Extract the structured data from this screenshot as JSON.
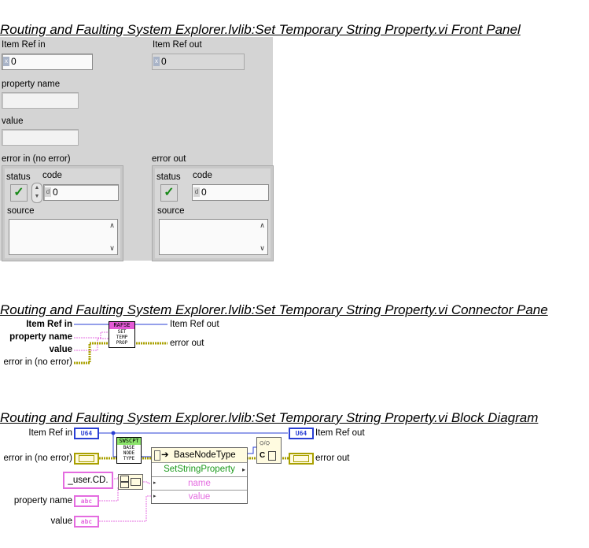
{
  "front_panel": {
    "title": "Routing and Faulting System Explorer.lvlib:Set Temporary String Property.vi Front Panel",
    "item_ref_in": {
      "label": "Item Ref in",
      "radix": "x",
      "value": "0"
    },
    "item_ref_out": {
      "label": "Item Ref out",
      "radix": "x",
      "value": "0"
    },
    "property_name": {
      "label": "property name",
      "value": ""
    },
    "value": {
      "label": "value",
      "value": ""
    },
    "error_in": {
      "label": "error in (no error)",
      "status_label": "status",
      "code_label": "code",
      "code_radix": "d",
      "code_value": "0",
      "source_label": "source",
      "status_glyph": "✓"
    },
    "error_out": {
      "label": "error out",
      "status_label": "status",
      "code_label": "code",
      "code_radix": "d",
      "code_value": "0",
      "source_label": "source",
      "status_glyph": "✓"
    }
  },
  "connector_pane": {
    "title": "Routing and Faulting System Explorer.lvlib:Set Temporary String Property.vi Connector Pane",
    "inputs": [
      "Item Ref in",
      "property name",
      "value",
      "error in (no error)"
    ],
    "outputs": [
      "Item Ref out",
      "error out"
    ],
    "icon_top": "RAFSE",
    "icon_lines": [
      "SET",
      "TEMP",
      "PROP"
    ]
  },
  "block_diagram": {
    "title": "Routing and Faulting System Explorer.lvlib:Set Temporary String Property.vi Block Diagram",
    "item_ref_in": "Item Ref in",
    "item_ref_out": "Item Ref out",
    "error_in": "error in (no error)",
    "error_out": "error out",
    "property_name": "property name",
    "value": "value",
    "u64_tag": "U64",
    "err_tag": "",
    "str_tag": "abc",
    "constant": "_user.CD.",
    "subvi_top": "SWSCPT",
    "subvi_lines": [
      "BASE",
      "NODE",
      "TYPE"
    ],
    "invoke_class": "BaseNodeType",
    "invoke_method": "SetStringProperty",
    "invoke_params": [
      "name",
      "value"
    ],
    "colors": {
      "wire_pink": "#e46ce0",
      "wire_blue": "#2a3fd4",
      "wire_error": "#a9a000",
      "method_green": "#1a9a1a"
    }
  }
}
